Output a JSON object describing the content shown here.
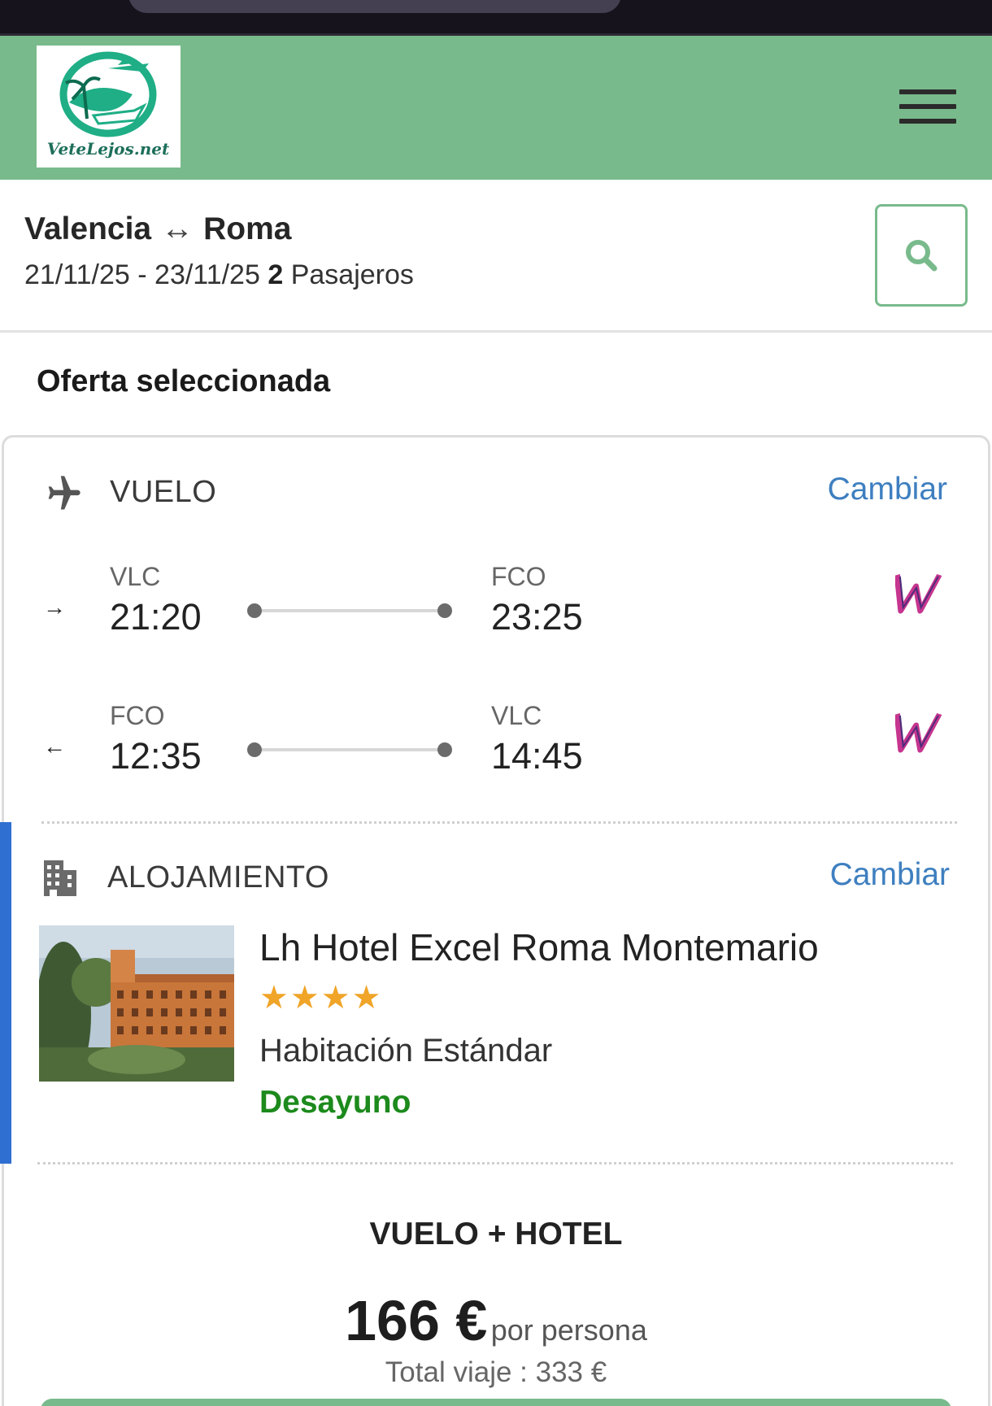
{
  "brand": {
    "logo_text": "VeteLejos.net",
    "color": "#79ba8c"
  },
  "search": {
    "origin": "Valencia",
    "destination": "Roma",
    "dates": "21/11/25 - 23/11/25",
    "passengers_count": "2",
    "passengers_label": "Pasajeros"
  },
  "offer": {
    "title": "Oferta seleccionada",
    "flight": {
      "label": "VUELO",
      "change": "Cambiar",
      "legs": [
        {
          "direction": "→",
          "from": "VLC",
          "depart": "21:20",
          "to": "FCO",
          "arrive": "23:25",
          "airline_icon": "wizz-air-logo"
        },
        {
          "direction": "←",
          "from": "FCO",
          "depart": "12:35",
          "to": "VLC",
          "arrive": "14:45",
          "airline_icon": "wizz-air-logo"
        }
      ]
    },
    "accommodation": {
      "label": "ALOJAMIENTO",
      "change": "Cambiar",
      "hotel_name": "Lh Hotel Excel Roma Montemario",
      "stars": 4,
      "stars_text": "★★★★",
      "room": "Habitación Estándar",
      "board": "Desayuno"
    },
    "package": {
      "title": "VUELO + HOTEL",
      "price": "166 €",
      "per": "por persona",
      "total": "Total viaje : 333 €"
    }
  },
  "colors": {
    "header": "#79ba8c",
    "link": "#3e7fc0",
    "board": "#1c8a1c",
    "star": "#f0a428",
    "accent_bar": "#2f6fd1"
  }
}
